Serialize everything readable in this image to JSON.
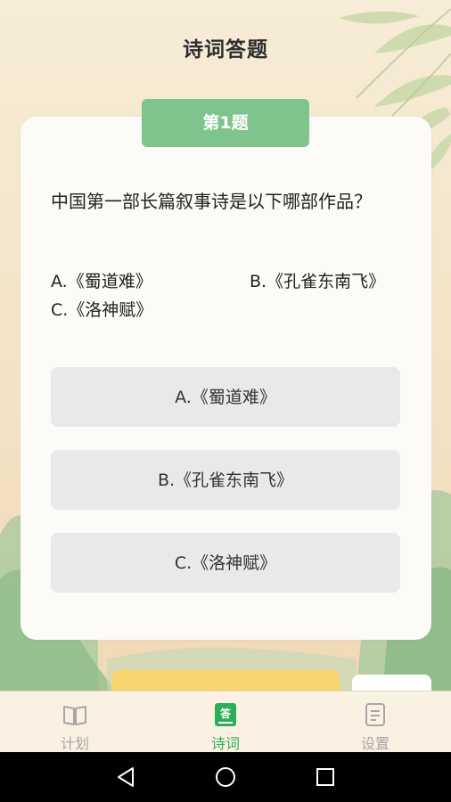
{
  "header": {
    "title": "诗词答题"
  },
  "question": {
    "badge": "第1题",
    "text": "中国第一部长篇叙事诗是以下哪部作品？",
    "options_text": {
      "a": "A.《蜀道难》",
      "b": "B.《孔雀东南飞》",
      "c": "C.《洛神赋》"
    }
  },
  "answers": [
    {
      "label": "A.《蜀道难》"
    },
    {
      "label": "B.《孔雀东南飞》"
    },
    {
      "label": "C.《洛神赋》"
    }
  ],
  "tabs": [
    {
      "label": "计划",
      "icon": "book-icon",
      "active": false
    },
    {
      "label": "诗词",
      "icon": "answer-icon",
      "active": true
    },
    {
      "label": "设置",
      "icon": "document-icon",
      "active": false
    }
  ],
  "colors": {
    "badge": "#7ec48c",
    "active_tab": "#2fae5a",
    "inactive_tab": "#a7a7a7",
    "answer_bg": "#e9e9e9"
  }
}
